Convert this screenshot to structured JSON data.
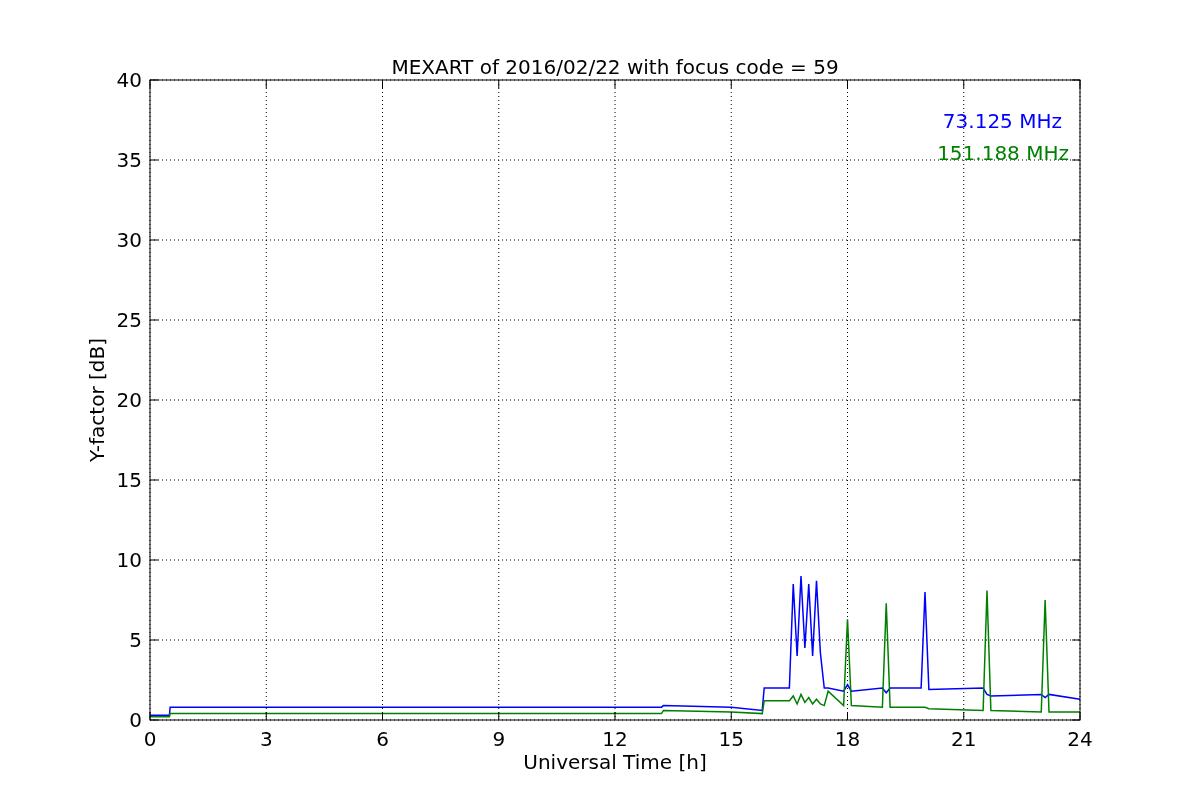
{
  "chart_data": {
    "type": "line",
    "title": "MEXART of 2016/02/22 with focus code = 59",
    "xlabel": "Universal Time [h]",
    "ylabel": "Y-factor [dB]",
    "x": [
      0,
      0.5,
      0.52,
      13.2,
      13.25,
      15,
      15.8,
      15.85,
      16.5,
      16.6,
      16.7,
      16.8,
      16.9,
      17,
      17.1,
      17.2,
      17.3,
      17.4,
      17.5,
      17.9,
      18,
      18.1,
      18.9,
      19,
      19.1,
      19.9,
      20,
      20.1,
      21.5,
      21.6,
      21.7,
      23,
      23.1,
      23.2,
      24
    ],
    "series": [
      {
        "name": "73.125 MHz",
        "color": "#0000ff",
        "values": [
          0.3,
          0.3,
          0.8,
          0.8,
          0.9,
          0.8,
          0.6,
          2,
          2,
          8.5,
          4,
          9,
          4.5,
          8.5,
          4,
          8.7,
          4.2,
          2,
          2,
          1.8,
          2.2,
          1.8,
          2,
          1.7,
          2,
          2,
          8,
          1.9,
          2,
          1.6,
          1.5,
          1.6,
          1.4,
          1.6,
          1.3
        ]
      },
      {
        "name": "151.188 MHz",
        "color": "#008000",
        "values": [
          0.2,
          0.2,
          0.4,
          0.4,
          0.6,
          0.5,
          0.4,
          1.2,
          1.2,
          1.5,
          1,
          1.6,
          1.1,
          1.4,
          1,
          1.3,
          1,
          0.9,
          1.8,
          0.9,
          6.3,
          0.9,
          0.8,
          7.3,
          0.8,
          0.8,
          0.8,
          0.7,
          0.6,
          8.1,
          0.6,
          0.5,
          7.5,
          0.5,
          0.5
        ]
      }
    ],
    "xlim": [
      0,
      24
    ],
    "ylim": [
      0,
      40
    ],
    "xticks": [
      0,
      3,
      6,
      9,
      12,
      15,
      18,
      21,
      24
    ],
    "yticks": [
      0,
      5,
      10,
      15,
      20,
      25,
      30,
      35,
      40
    ],
    "grid": true
  }
}
